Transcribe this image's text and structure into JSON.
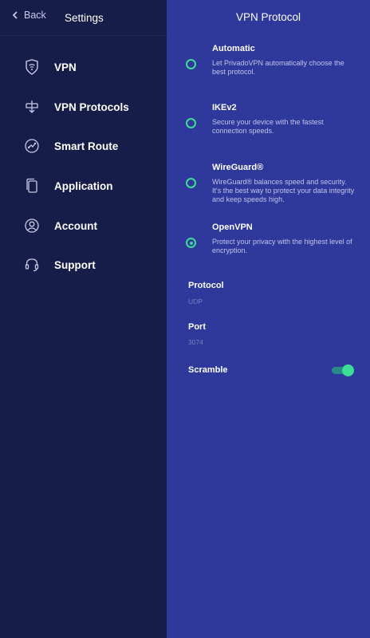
{
  "sidebar": {
    "back_label": "Back",
    "title": "Settings",
    "items": [
      {
        "label": "VPN",
        "icon": "shield-wifi-icon"
      },
      {
        "label": "VPN Protocols",
        "icon": "protocol-icon"
      },
      {
        "label": "Smart Route",
        "icon": "route-icon"
      },
      {
        "label": "Application",
        "icon": "devices-icon"
      },
      {
        "label": "Account",
        "icon": "user-icon"
      },
      {
        "label": "Support",
        "icon": "headset-icon"
      }
    ]
  },
  "main": {
    "title": "VPN Protocol",
    "options": [
      {
        "title": "Automatic",
        "description": "Let PrivadoVPN automatically choose the best protocol.",
        "selected": false
      },
      {
        "title": "IKEv2",
        "description": "Secure your device with the fastest connection speeds.",
        "selected": false
      },
      {
        "title": "WireGuard®",
        "description": "WireGuard® balances speed and security. It's the best way to protect your data integrity and keep speeds high.",
        "selected": false
      },
      {
        "title": "OpenVPN",
        "description": "Protect your privacy with the highest level of encryption.",
        "selected": true
      }
    ],
    "protocol": {
      "label": "Protocol",
      "value": "UDP"
    },
    "port": {
      "label": "Port",
      "value": "3074"
    },
    "scramble": {
      "label": "Scramble",
      "enabled": true
    }
  },
  "colors": {
    "sidebar_bg": "#171d49",
    "main_bg": "#2f399b",
    "accent": "#3ddc97"
  }
}
